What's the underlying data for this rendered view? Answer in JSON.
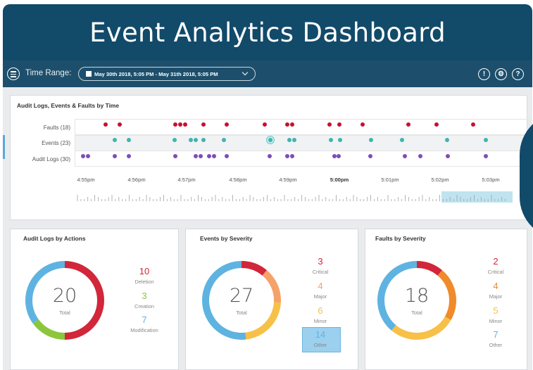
{
  "title": "Event Analytics Dashboard",
  "header": {
    "time_range_label": "Time Range:",
    "time_range_value": "May 30th 2018, 5:05 PM - May 31th 2018, 5:05 PM",
    "icons": [
      "menu-icon",
      "alert-icon",
      "gear-icon",
      "help-icon"
    ],
    "alert_glyph": "!",
    "gear_glyph": "⚙",
    "help_glyph": "?"
  },
  "timeline_panel": {
    "title": "Audit Logs, Events & Faults by Time",
    "rows": [
      {
        "label": "Faults (18)",
        "color": "#c8102e"
      },
      {
        "label": "Events (23)",
        "color": "#3fb3b3"
      },
      {
        "label": "Audit Logs (30)",
        "color": "#7e4db8"
      }
    ],
    "ticks": [
      "4:55pm",
      "4:56pm",
      "4:57pm",
      "4:58pm",
      "4:59pm",
      "5:00pm",
      "5:01pm",
      "5:02pm",
      "5:03pm"
    ],
    "bold_tick": "5:00pm"
  },
  "audit_panel": {
    "title": "Audit Logs by Actions",
    "total": "20",
    "total_label": "Total",
    "legend": [
      {
        "value": "10",
        "label": "Deletion",
        "color": "#d2263a"
      },
      {
        "value": "3",
        "label": "Creation",
        "color": "#8cc63f"
      },
      {
        "value": "7",
        "label": "Modification",
        "color": "#5fb3e0"
      }
    ]
  },
  "events_panel": {
    "title": "Events by Severity",
    "total": "27",
    "total_label": "Total",
    "legend": [
      {
        "value": "3",
        "label": "Critical",
        "color": "#d2263a"
      },
      {
        "value": "4",
        "label": "Major",
        "color": "#f5a26a"
      },
      {
        "value": "6",
        "label": "Minor",
        "color": "#f7c048"
      },
      {
        "value": "14",
        "label": "Other",
        "color": "#5fb3e0"
      }
    ]
  },
  "faults_panel": {
    "title": "Faults by Severity",
    "total": "18",
    "total_label": "Total",
    "legend": [
      {
        "value": "2",
        "label": "Critical",
        "color": "#d2263a"
      },
      {
        "value": "4",
        "label": "Major",
        "color": "#f08a2a"
      },
      {
        "value": "5",
        "label": "Minor",
        "color": "#f7c048"
      },
      {
        "value": "7",
        "label": "Other",
        "color": "#5fb3e0"
      }
    ]
  }
}
